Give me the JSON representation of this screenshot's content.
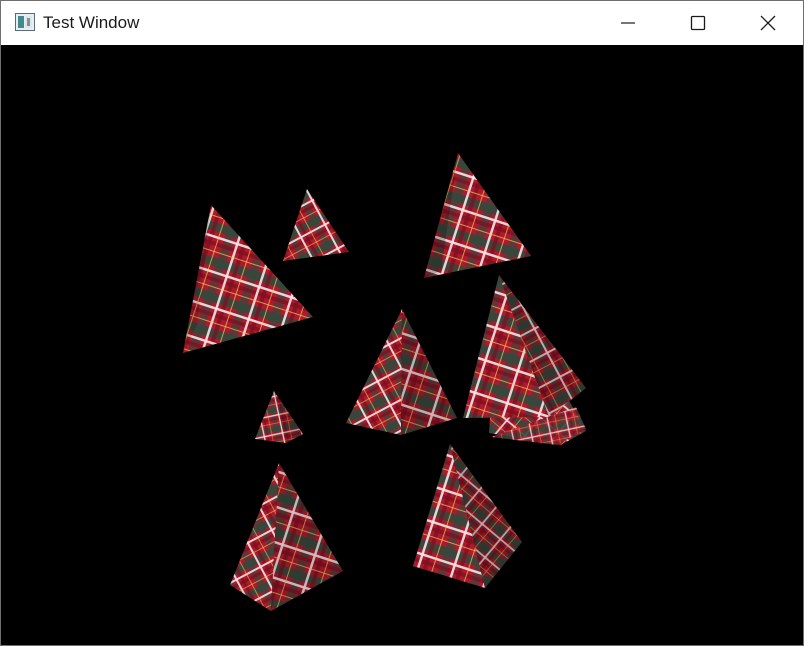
{
  "window": {
    "title": "Test Window",
    "app_icon": "window-app-icon",
    "controls": {
      "minimize_icon": "minimize-icon",
      "maximize_icon": "maximize-icon",
      "close_icon": "close-icon"
    }
  },
  "content": {
    "background": "#000000",
    "texture": {
      "name": "red-tartan-plaid",
      "colors": {
        "base": "#b0182c",
        "dark_band": "#2e4a3c",
        "light_stripe": "#f2e8e8",
        "thin_stripe": "#e8d05a"
      }
    },
    "object_count": 9
  }
}
